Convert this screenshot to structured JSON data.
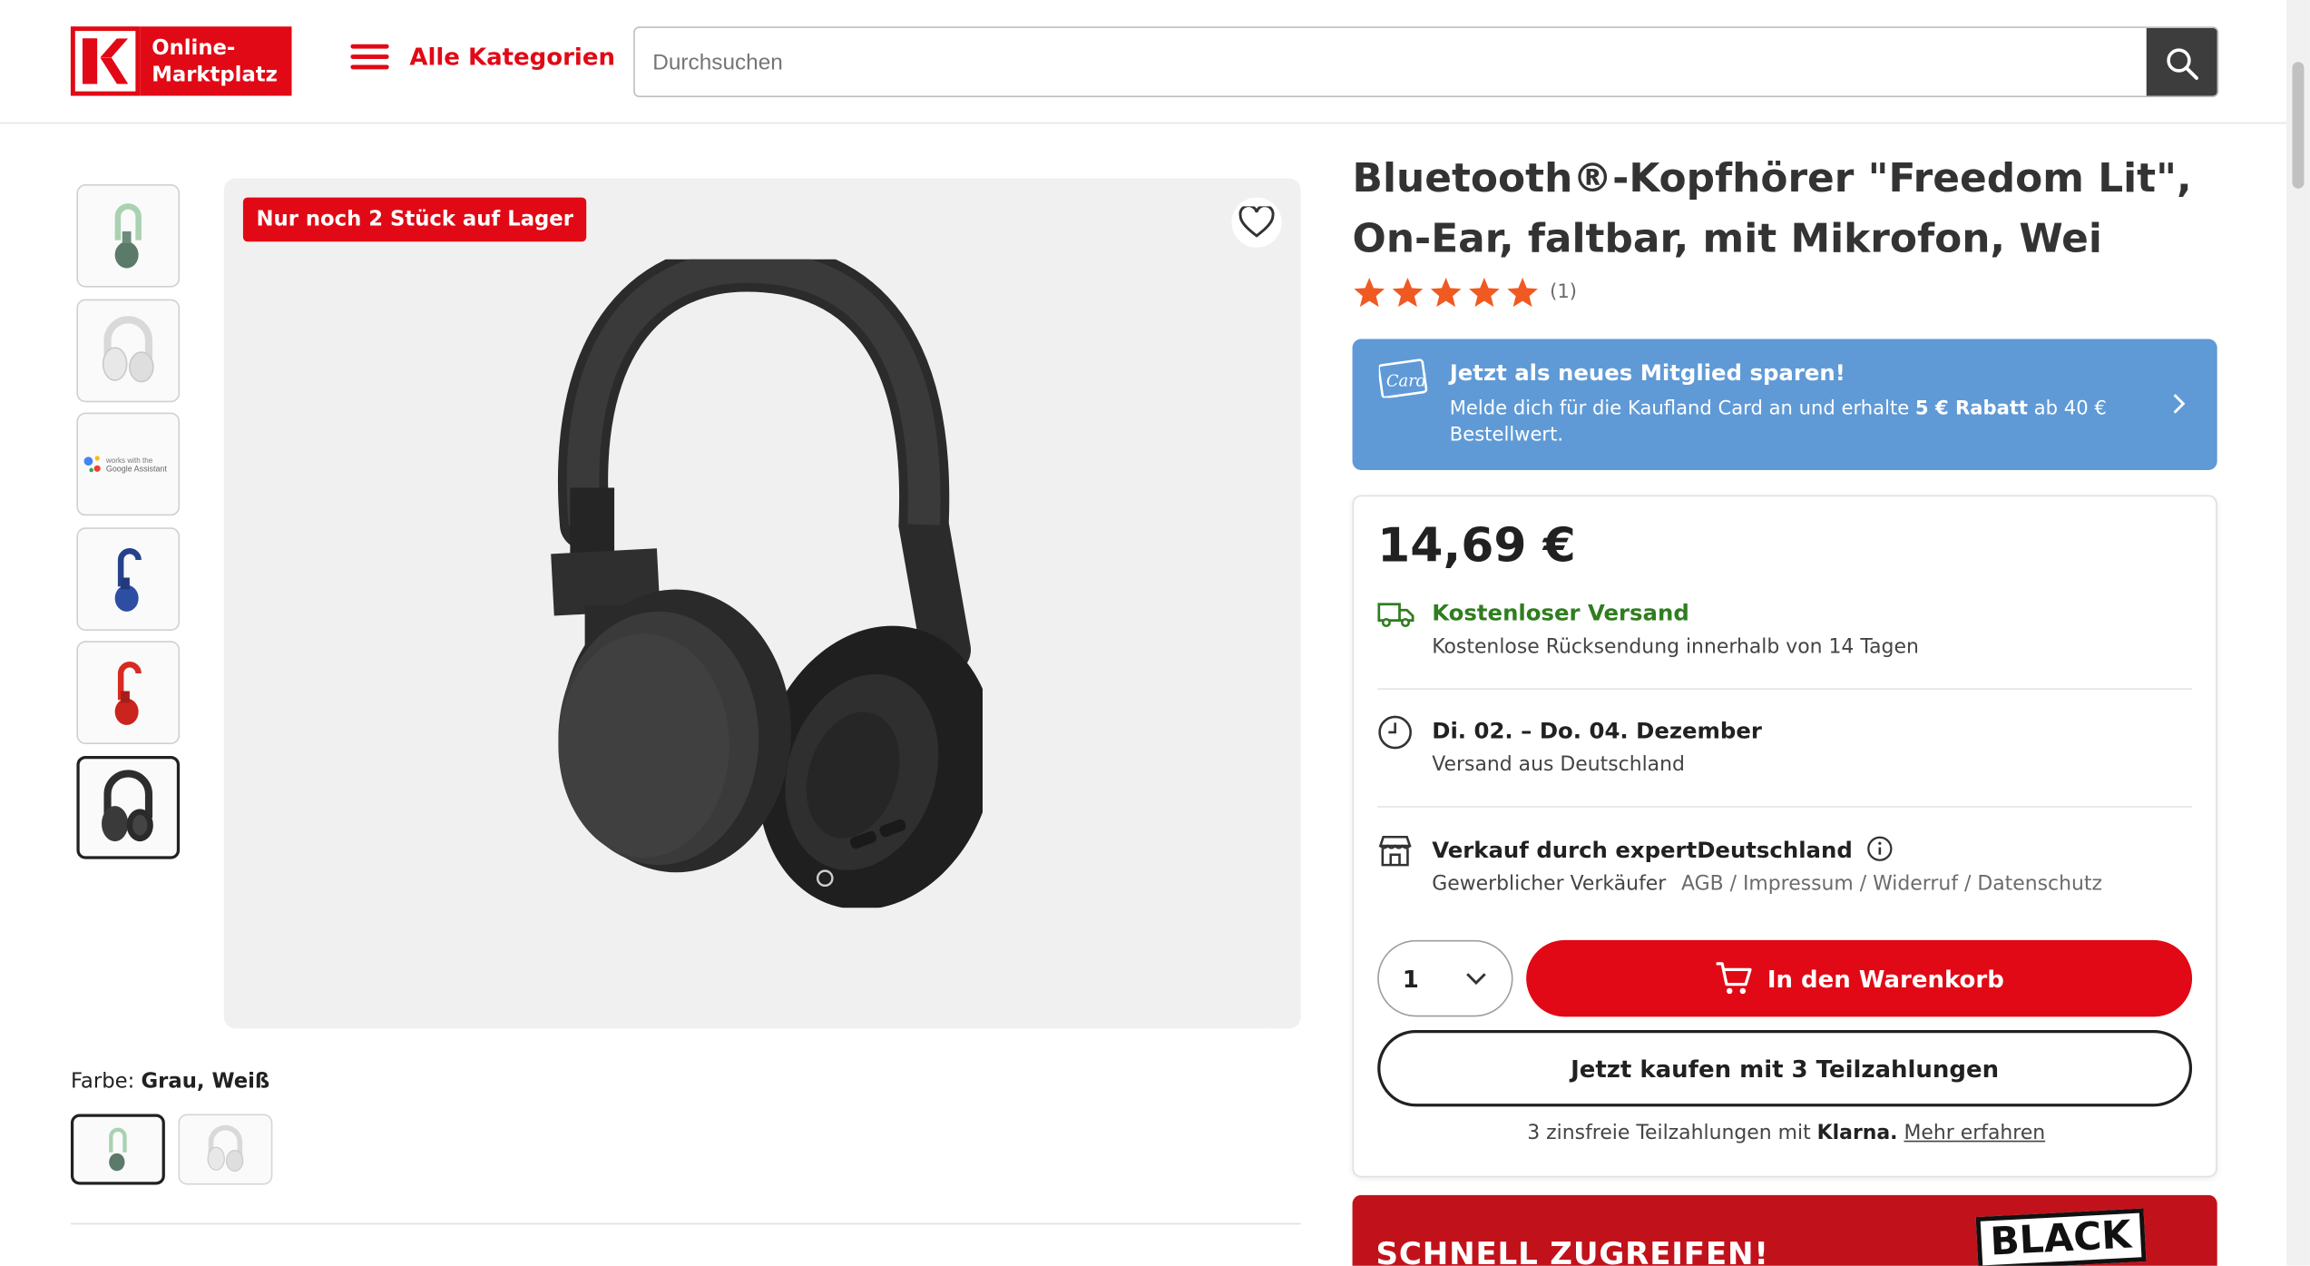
{
  "header": {
    "logo_line1": "Online-",
    "logo_line2": "Marktplatz",
    "menu_label": "Alle Kategorien",
    "search_placeholder": "Durchsuchen"
  },
  "gallery": {
    "stock_badge": "Nur noch 2 Stück auf Lager",
    "thumbnails": [
      "green-headphone",
      "white-headphone",
      "google-assistant-logo",
      "blue-headphone",
      "red-headphone",
      "black-headphone"
    ],
    "google_text": "works with the Google Assistant"
  },
  "variants": {
    "label": "Farbe:",
    "selected": "Grau, Weiß"
  },
  "product": {
    "title": "Bluetooth®-Kopfhörer \"Freedom Lit\", On-Ear, faltbar, mit Mikrofon, Wei",
    "rating_stars": 5,
    "rating_count": "(1)"
  },
  "promo": {
    "card_label": "Card",
    "title": "Jetzt als neues Mitglied sparen!",
    "text_before": "Melde dich für die Kaufland Card an und erhalte ",
    "text_bold": "5 € Rabatt",
    "text_after": " ab 40 € Bestellwert."
  },
  "buybox": {
    "price": "14,69 €",
    "shipping_title": "Kostenloser Versand",
    "shipping_sub": "Kostenlose Rücksendung innerhalb von 14 Tagen",
    "delivery_title": "Di. 02. – Do. 04. Dezember",
    "delivery_sub": "Versand aus Deutschland",
    "seller_title": "Verkauf durch expertDeutschland",
    "seller_type": "Gewerblicher Verkäufer",
    "seller_links": "AGB / Impressum / Widerruf / Datenschutz",
    "quantity": "1",
    "cart_label": "In den Warenkorb",
    "klarna_label": "Jetzt kaufen mit 3 Teilzahlungen",
    "klarna_note": "3 zinsfreie Teilzahlungen mit",
    "klarna_brand": "Klarna.",
    "klarna_link": "Mehr erfahren"
  },
  "banner": {
    "text": "SCHNELL ZUGREIFEN!",
    "badge": "BLACK"
  },
  "colors": {
    "brand_red": "#e10915",
    "promo_blue": "#5f9ad6",
    "shipping_green": "#2f7d1f",
    "star_orange": "#f05a22"
  }
}
